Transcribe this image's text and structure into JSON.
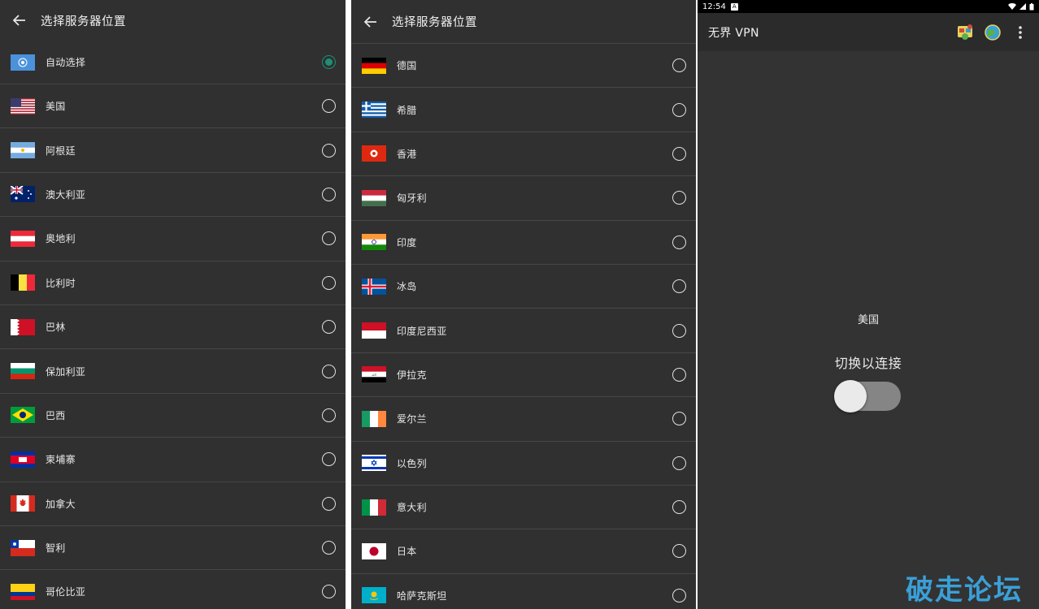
{
  "panel1": {
    "title": "选择服务器位置",
    "items": [
      {
        "label": "自动选择",
        "flag": "un",
        "selected": true
      },
      {
        "label": "美国",
        "flag": "us",
        "selected": false
      },
      {
        "label": "阿根廷",
        "flag": "ar",
        "selected": false
      },
      {
        "label": "澳大利亚",
        "flag": "au",
        "selected": false
      },
      {
        "label": "奥地利",
        "flag": "at",
        "selected": false
      },
      {
        "label": "比利时",
        "flag": "be",
        "selected": false
      },
      {
        "label": "巴林",
        "flag": "bh",
        "selected": false
      },
      {
        "label": "保加利亚",
        "flag": "bg",
        "selected": false
      },
      {
        "label": "巴西",
        "flag": "br",
        "selected": false
      },
      {
        "label": "柬埔寨",
        "flag": "kh",
        "selected": false
      },
      {
        "label": "加拿大",
        "flag": "ca",
        "selected": false
      },
      {
        "label": "智利",
        "flag": "cl",
        "selected": false
      },
      {
        "label": "哥伦比亚",
        "flag": "co",
        "selected": false
      }
    ]
  },
  "panel2": {
    "title": "选择服务器位置",
    "items": [
      {
        "label": "德国",
        "flag": "de",
        "selected": false
      },
      {
        "label": "希腊",
        "flag": "gr",
        "selected": false
      },
      {
        "label": "香港",
        "flag": "hk",
        "selected": false
      },
      {
        "label": "匈牙利",
        "flag": "hu",
        "selected": false
      },
      {
        "label": "印度",
        "flag": "in",
        "selected": false
      },
      {
        "label": "冰岛",
        "flag": "is",
        "selected": false
      },
      {
        "label": "印度尼西亚",
        "flag": "id",
        "selected": false
      },
      {
        "label": "伊拉克",
        "flag": "iq",
        "selected": false
      },
      {
        "label": "爱尔兰",
        "flag": "ie",
        "selected": false
      },
      {
        "label": "以色列",
        "flag": "il",
        "selected": false
      },
      {
        "label": "意大利",
        "flag": "it",
        "selected": false
      },
      {
        "label": "日本",
        "flag": "jp",
        "selected": false
      },
      {
        "label": "哈萨克斯坦",
        "flag": "kz",
        "selected": false
      }
    ]
  },
  "panel3": {
    "status": {
      "time": "12:54",
      "badge": "A"
    },
    "app_title": "无界 VPN",
    "country": "美国",
    "switch_label": "切换以连接",
    "switch_on": false,
    "watermark": "破走论坛"
  },
  "colors": {
    "background": "#303030",
    "accent": "#1e8f72",
    "divider": "#474747",
    "watermark": "#3aa0d8"
  }
}
